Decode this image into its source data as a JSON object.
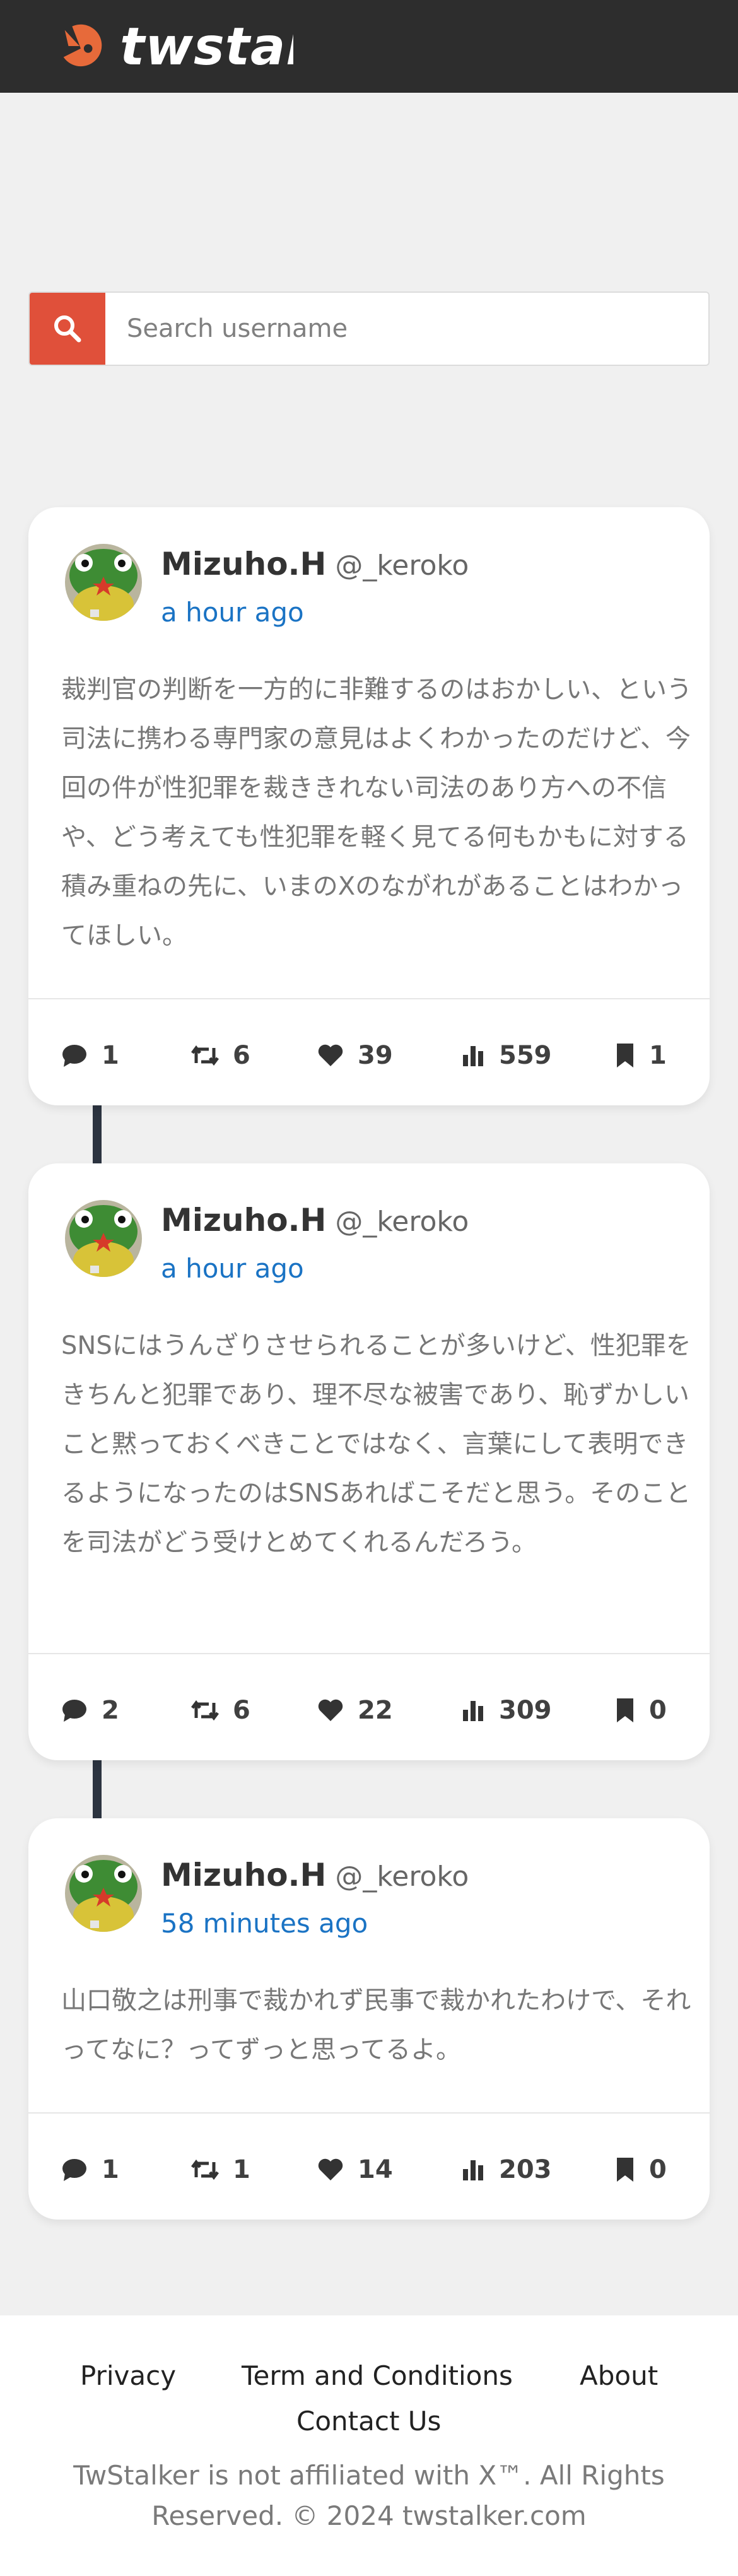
{
  "header": {
    "logo_text": "twstal",
    "logo_icon": "twstalker-logo-icon",
    "colors": {
      "bar": "#2d2d2d",
      "accent": "#e76a3a"
    }
  },
  "search": {
    "placeholder": "Search username",
    "icon": "search-icon",
    "button_color": "#e0503a"
  },
  "tweets": [
    {
      "name": "Mizuho.H",
      "handle": "@_keroko",
      "time": "a hour ago",
      "content": "裁判官の判断を一方的に非難するのはおかしい、という司法に携わる専門家の意見はよくわかったのだけど、今回の件が性犯罪を裁ききれない司法のあり方への不信や、どう考えても性犯罪を軽く見てる何もかもに対する積み重ねの先に、いまのXのながれがあることはわかってほしい。",
      "stats": {
        "replies": "1",
        "retweets": "6",
        "likes": "39",
        "views": "559",
        "bookmarks": "1"
      }
    },
    {
      "name": "Mizuho.H",
      "handle": "@_keroko",
      "time": "a hour ago",
      "content": "SNSにはうんざりさせられることが多いけど、性犯罪をきちんと犯罪であり、理不尽な被害であり、恥ずかしいこと黙っておくべきことではなく、言葉にして表明できるようになったのはSNSあればこそだと思う。そのことを司法がどう受けとめてくれるんだろう。",
      "stats": {
        "replies": "2",
        "retweets": "6",
        "likes": "22",
        "views": "309",
        "bookmarks": "0"
      }
    },
    {
      "name": "Mizuho.H",
      "handle": "@_keroko",
      "time": "58 minutes ago",
      "content": "山口敬之は刑事で裁かれず民事で裁かれたわけで、それってなに？ってずっと思ってるよ。",
      "stats": {
        "replies": "1",
        "retweets": "1",
        "likes": "14",
        "views": "203",
        "bookmarks": "0"
      }
    }
  ],
  "footer": {
    "links": [
      "Privacy",
      "Term and Conditions",
      "About",
      "Contact Us"
    ],
    "copyright": "TwStalker is not affiliated with X™. All Rights Reserved. © 2024 twstalker.com"
  }
}
